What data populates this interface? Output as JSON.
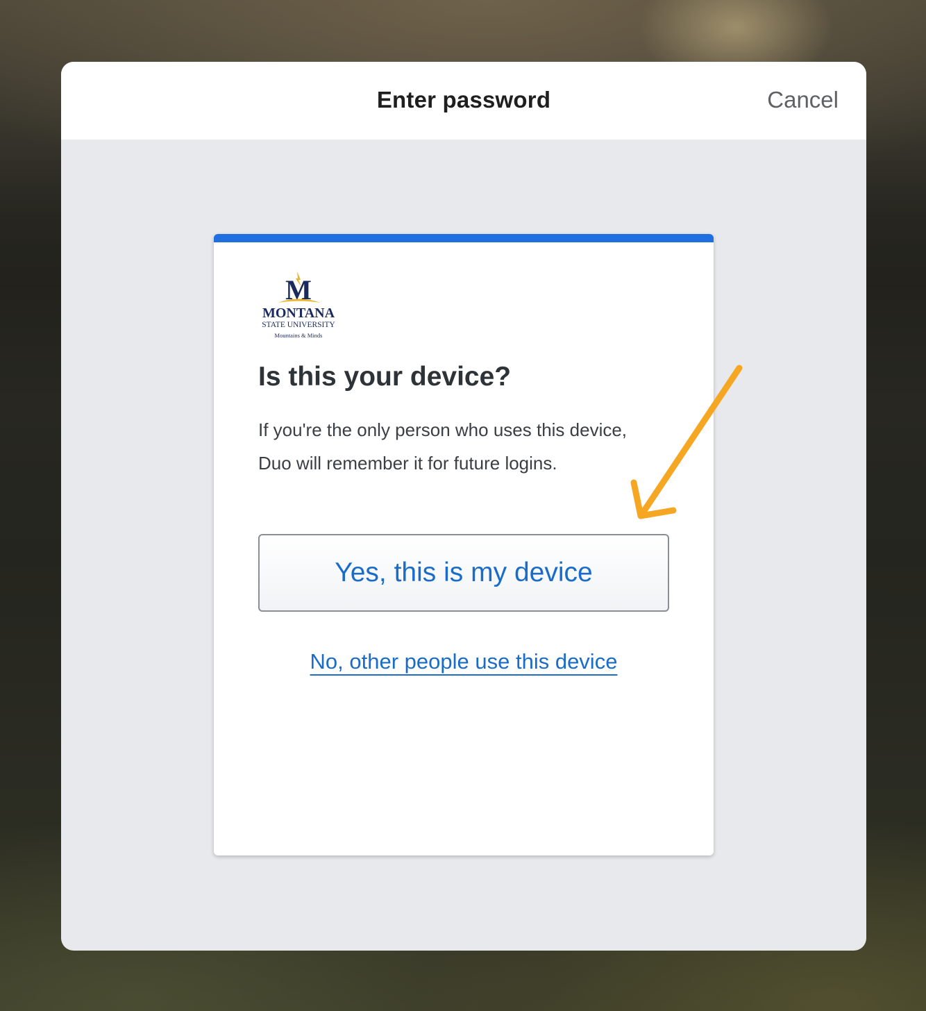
{
  "sheet": {
    "title": "Enter password",
    "cancel_label": "Cancel"
  },
  "card": {
    "logo": {
      "name": "montana-state-university-logo",
      "line1": "MONTANA",
      "line2": "STATE UNIVERSITY",
      "line3": "Mountains & Minds",
      "monogram": "M"
    },
    "heading": "Is this your device?",
    "description_line1": "If you're the only person who uses this device,",
    "description_line2": "Duo will remember it for future logins.",
    "yes_button_label": "Yes, this is my device",
    "no_link_label": "No, other people use this device"
  },
  "colors": {
    "accent_blue": "#1f6fe0",
    "link_blue": "#1a6cc9",
    "annotation_arrow": "#f5a623",
    "logo_navy": "#1b2a5c",
    "logo_gold": "#e8b324"
  },
  "annotation": {
    "icon": "arrow-pointer-icon"
  }
}
